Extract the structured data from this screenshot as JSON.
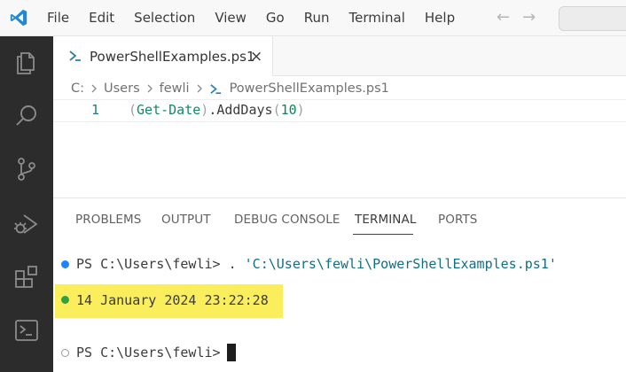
{
  "menu": {
    "items": [
      "File",
      "Edit",
      "Selection",
      "View",
      "Go",
      "Run",
      "Terminal",
      "Help"
    ],
    "back_icon": "arrow-left-icon",
    "forward_icon": "arrow-right-icon"
  },
  "activity_bar": {
    "icons": [
      "explorer-icon",
      "search-icon",
      "source-control-icon",
      "run-debug-icon",
      "extensions-icon",
      "terminal-icon"
    ]
  },
  "editor": {
    "tab": {
      "label": "PowerShellExamples.ps1",
      "close": "×"
    },
    "breadcrumbs": [
      "C:",
      "Users",
      "fewli",
      "PowerShellExamples.ps1"
    ],
    "line_number": "1",
    "code": {
      "paren_open": "(",
      "command": "Get-Date",
      "paren_close": ")",
      "dot": ".",
      "method": "AddDays",
      "arg_open": "(",
      "arg": "10",
      "arg_close": ")"
    }
  },
  "panel": {
    "tabs": [
      "PROBLEMS",
      "OUTPUT",
      "DEBUG CONSOLE",
      "TERMINAL",
      "PORTS"
    ],
    "active_tab": "TERMINAL"
  },
  "terminal": {
    "line1_prompt": "PS C:\\Users\\fewli> . ",
    "line1_path": "'C:\\Users\\fewli\\PowerShellExamples.ps1'",
    "output": "14 January 2024 23:22:28",
    "line3_prompt": "PS C:\\Users\\fewli> "
  },
  "colors": {
    "activity_bar": "#2c2c2c",
    "highlight": "#fbee5c",
    "accent_blue": "#1a85ff",
    "success_green": "#2ea043"
  }
}
